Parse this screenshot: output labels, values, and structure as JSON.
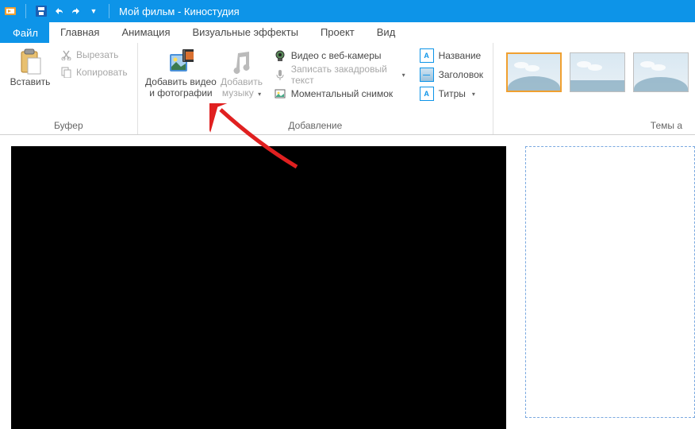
{
  "titlebar": {
    "title": "Мой фильм - Киностудия"
  },
  "tabs": {
    "file": "Файл",
    "home": "Главная",
    "animation": "Анимация",
    "effects": "Визуальные эффекты",
    "project": "Проект",
    "view": "Вид"
  },
  "ribbon": {
    "buffer": {
      "label": "Буфер",
      "paste": "Вставить",
      "cut": "Вырезать",
      "copy": "Копировать"
    },
    "add": {
      "label": "Добавление",
      "add_video_photos_l1": "Добавить видео",
      "add_video_photos_l2": "и фотографии",
      "add_music_l1": "Добавить",
      "add_music_l2": "музыку",
      "webcam": "Видео с веб-камеры",
      "narration": "Записать закадровый текст",
      "snapshot": "Моментальный снимок"
    },
    "captions": {
      "title": "Название",
      "header": "Заголовок",
      "credits": "Титры"
    },
    "themes": {
      "label": "Темы а"
    }
  }
}
